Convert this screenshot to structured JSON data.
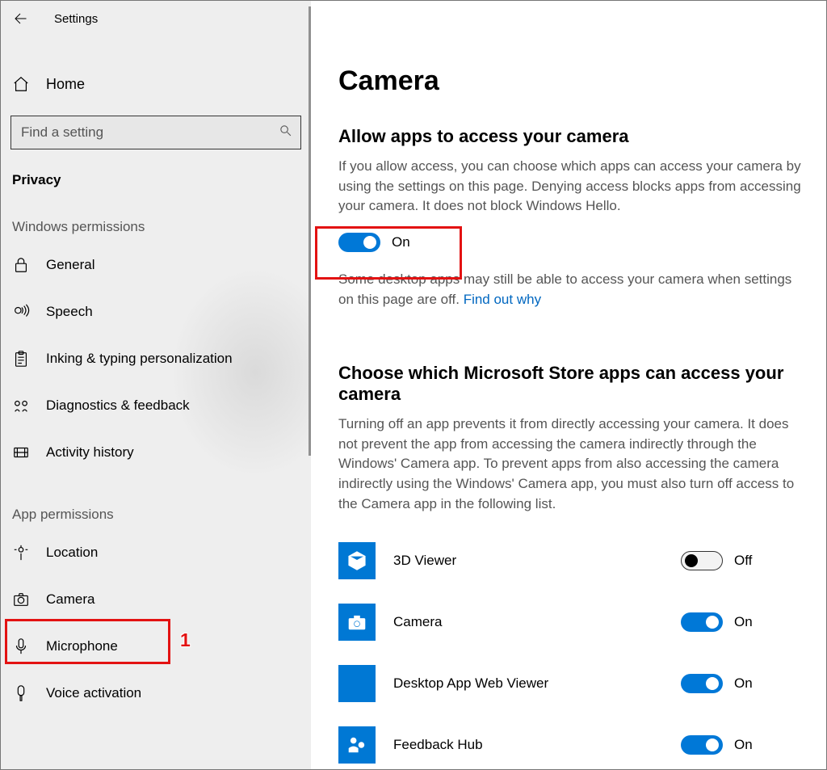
{
  "window": {
    "title": "Settings"
  },
  "sidebar": {
    "home_label": "Home",
    "search_placeholder": "Find a setting",
    "section_label": "Privacy",
    "group_windows_permissions": "Windows permissions",
    "group_app_permissions": "App permissions",
    "items_windows": [
      {
        "icon": "lock-icon",
        "label": "General"
      },
      {
        "icon": "speech-icon",
        "label": "Speech"
      },
      {
        "icon": "clipboard-icon",
        "label": "Inking & typing personalization"
      },
      {
        "icon": "feedback-icon",
        "label": "Diagnostics & feedback"
      },
      {
        "icon": "history-icon",
        "label": "Activity history"
      }
    ],
    "items_app": [
      {
        "icon": "location-icon",
        "label": "Location"
      },
      {
        "icon": "camera-icon",
        "label": "Camera"
      },
      {
        "icon": "microphone-icon",
        "label": "Microphone"
      },
      {
        "icon": "voice-icon",
        "label": "Voice activation"
      }
    ]
  },
  "main": {
    "title": "Camera",
    "section1_heading": "Allow apps to access your camera",
    "section1_body": "If you allow access, you can choose which apps can access your camera by using the settings on this page. Denying access blocks apps from accessing your camera. It does not block Windows Hello.",
    "master_toggle_state": "On",
    "note_prefix": "Some desktop apps may still be able to access your camera when settings on this page are off. ",
    "note_link": "Find out why",
    "section2_heading": "Choose which Microsoft Store apps can access your camera",
    "section2_body": "Turning off an app prevents it from directly accessing your camera. It does not prevent the app from accessing the camera indirectly through the Windows' Camera app. To prevent apps from also accessing the camera indirectly using the Windows' Camera app, you must also turn off access to the Camera app in the following list.",
    "apps": [
      {
        "name": "3D Viewer",
        "state": "Off"
      },
      {
        "name": "Camera",
        "state": "On"
      },
      {
        "name": "Desktop App Web Viewer",
        "state": "On"
      },
      {
        "name": "Feedback Hub",
        "state": "On"
      }
    ]
  },
  "annotations": {
    "camera_nav_number": "1"
  }
}
